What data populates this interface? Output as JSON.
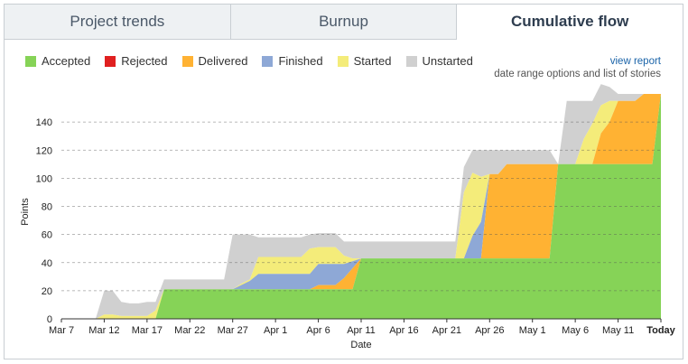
{
  "tabs": [
    {
      "label": "Project trends"
    },
    {
      "label": "Burnup"
    },
    {
      "label": "Cumulative flow"
    }
  ],
  "links": {
    "view_report": "view report",
    "date_range": "date range options and list of stories"
  },
  "colors": {
    "Accepted": "#86d357",
    "Rejected": "#e02020",
    "Delivered": "#ffb233",
    "Finished": "#8ea8d6",
    "Started": "#f4ec7a",
    "Unstarted": "#d0d0d0"
  },
  "chart_data": {
    "type": "area",
    "stacked": true,
    "xlabel": "Date",
    "ylabel": "Points",
    "ylim": [
      0,
      160
    ],
    "yticks": [
      0,
      20,
      40,
      60,
      80,
      100,
      120,
      140
    ],
    "xlim": [
      0,
      64
    ],
    "xticks": [
      {
        "x": 0,
        "label": "Mar 7"
      },
      {
        "x": 5,
        "label": "Mar 12"
      },
      {
        "x": 10,
        "label": "Mar 17"
      },
      {
        "x": 15,
        "label": "Mar 22"
      },
      {
        "x": 20,
        "label": "Mar 27"
      },
      {
        "x": 25,
        "label": "Apr 1"
      },
      {
        "x": 30,
        "label": "Apr 6"
      },
      {
        "x": 35,
        "label": "Apr 11"
      },
      {
        "x": 40,
        "label": "Apr 16"
      },
      {
        "x": 45,
        "label": "Apr 21"
      },
      {
        "x": 50,
        "label": "Apr 26"
      },
      {
        "x": 55,
        "label": "May 1"
      },
      {
        "x": 60,
        "label": "May 6"
      },
      {
        "x": 65,
        "label": "May 11"
      },
      {
        "x": 70,
        "label": "Today"
      }
    ],
    "legend": [
      "Accepted",
      "Rejected",
      "Delivered",
      "Finished",
      "Started",
      "Unstarted"
    ],
    "grid": true,
    "x": [
      0,
      1,
      2,
      3,
      4,
      5,
      6,
      7,
      8,
      9,
      10,
      11,
      12,
      13,
      14,
      15,
      16,
      17,
      18,
      19,
      20,
      21,
      22,
      23,
      24,
      25,
      26,
      27,
      28,
      29,
      30,
      31,
      32,
      33,
      34,
      35,
      36,
      37,
      38,
      39,
      40,
      41,
      42,
      43,
      44,
      45,
      46,
      47,
      48,
      49,
      50,
      51,
      52,
      53,
      54,
      55,
      56,
      57,
      58,
      59,
      60,
      61,
      62,
      63,
      64,
      65,
      66,
      67,
      68,
      69,
      70
    ],
    "series": [
      {
        "name": "Accepted",
        "values": [
          0,
          0,
          0,
          0,
          0,
          0,
          0,
          0,
          0,
          0,
          0,
          0,
          21,
          21,
          21,
          21,
          21,
          21,
          21,
          21,
          21,
          21,
          21,
          21,
          21,
          21,
          21,
          21,
          21,
          21,
          21,
          21,
          21,
          21,
          21,
          43,
          43,
          43,
          43,
          43,
          43,
          43,
          43,
          43,
          43,
          43,
          43,
          43,
          43,
          43,
          43,
          43,
          43,
          43,
          43,
          43,
          43,
          43,
          110,
          110,
          110,
          110,
          110,
          110,
          110,
          110,
          110,
          110,
          110,
          110,
          160
        ]
      },
      {
        "name": "Rejected",
        "values": [
          0,
          0,
          0,
          0,
          0,
          0,
          0,
          0,
          0,
          0,
          0,
          0,
          0,
          0,
          0,
          0,
          0,
          0,
          0,
          0,
          0,
          0,
          0,
          0,
          0,
          0,
          0,
          0,
          0,
          0,
          0,
          0,
          0,
          0,
          0,
          0,
          0,
          0,
          0,
          0,
          0,
          0,
          0,
          0,
          0,
          0,
          0,
          0,
          0,
          0,
          0,
          0,
          0,
          0,
          0,
          0,
          0,
          0,
          0,
          0,
          0,
          0,
          0,
          0,
          0,
          0,
          0,
          0,
          0,
          0,
          0
        ]
      },
      {
        "name": "Delivered",
        "values": [
          0,
          0,
          0,
          0,
          0,
          0,
          0,
          0,
          0,
          0,
          0,
          0,
          0,
          0,
          0,
          0,
          0,
          0,
          0,
          0,
          0,
          0,
          0,
          0,
          0,
          0,
          0,
          0,
          0,
          0,
          3,
          3,
          3,
          8,
          15,
          0,
          0,
          0,
          0,
          0,
          0,
          0,
          0,
          0,
          0,
          0,
          0,
          0,
          0,
          0,
          60,
          60,
          67,
          67,
          67,
          67,
          67,
          67,
          0,
          0,
          0,
          0,
          0,
          22,
          30,
          45,
          45,
          45,
          50,
          50,
          0
        ]
      },
      {
        "name": "Finished",
        "values": [
          0,
          0,
          0,
          0,
          0,
          0,
          0,
          0,
          0,
          0,
          0,
          0,
          0,
          0,
          0,
          0,
          0,
          0,
          0,
          0,
          0,
          3,
          6,
          11,
          11,
          11,
          11,
          11,
          11,
          11,
          15,
          15,
          15,
          10,
          5,
          0,
          0,
          0,
          0,
          0,
          0,
          0,
          0,
          0,
          0,
          0,
          0,
          0,
          16,
          26,
          0,
          0,
          0,
          0,
          0,
          0,
          0,
          0,
          0,
          0,
          0,
          0,
          0,
          0,
          0,
          0,
          0,
          0,
          0,
          0,
          0
        ]
      },
      {
        "name": "Started",
        "values": [
          0,
          0,
          0,
          0,
          0,
          3,
          3,
          2,
          2,
          2,
          2,
          6,
          0,
          0,
          0,
          0,
          0,
          0,
          0,
          0,
          0,
          1,
          1,
          12,
          12,
          12,
          12,
          12,
          12,
          18,
          12,
          12,
          12,
          6,
          2,
          0,
          0,
          0,
          0,
          0,
          0,
          0,
          0,
          0,
          0,
          0,
          0,
          47,
          45,
          32,
          0,
          0,
          0,
          0,
          0,
          0,
          0,
          0,
          0,
          0,
          0,
          18,
          29,
          20,
          15,
          0,
          0,
          0,
          0,
          0,
          0
        ]
      },
      {
        "name": "Unstarted",
        "values": [
          0,
          0,
          0,
          0,
          0,
          17,
          17,
          10,
          9,
          9,
          10,
          6,
          7,
          7,
          7,
          7,
          7,
          7,
          7,
          7,
          39,
          35,
          32,
          14,
          14,
          14,
          14,
          14,
          14,
          10,
          10,
          10,
          10,
          10,
          12,
          12,
          12,
          12,
          12,
          12,
          12,
          12,
          12,
          12,
          12,
          12,
          12,
          18,
          16,
          19,
          17,
          17,
          10,
          10,
          10,
          10,
          10,
          10,
          0,
          45,
          45,
          27,
          16,
          15,
          10,
          5,
          5,
          5,
          0,
          0,
          0
        ]
      }
    ]
  }
}
